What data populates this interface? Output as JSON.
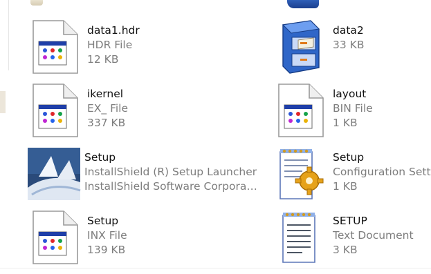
{
  "items": [
    {
      "name": "data1.hdr",
      "type": "HDR File",
      "size": "12 KB",
      "icon": "app-file-icon"
    },
    {
      "name": "data2",
      "type": "33 KB",
      "size": "",
      "icon": "cabinet-file-icon"
    },
    {
      "name": "ikernel",
      "type": "EX_ File",
      "size": "337 KB",
      "icon": "app-file-icon"
    },
    {
      "name": "layout",
      "type": "BIN File",
      "size": "1 KB",
      "icon": "app-file-icon"
    },
    {
      "name": "Setup",
      "type": "InstallShield (R) Setup Launcher",
      "size": "InstallShield Software Corpora…",
      "icon": "installshield-setup-icon"
    },
    {
      "name": "Setup",
      "type": "Configuration Sett",
      "size": "1 KB",
      "icon": "config-settings-icon"
    },
    {
      "name": "Setup",
      "type": "INX File",
      "size": "139 KB",
      "icon": "app-file-icon"
    },
    {
      "name": "SETUP",
      "type": "Text Document",
      "size": "3 KB",
      "icon": "text-document-icon"
    }
  ]
}
